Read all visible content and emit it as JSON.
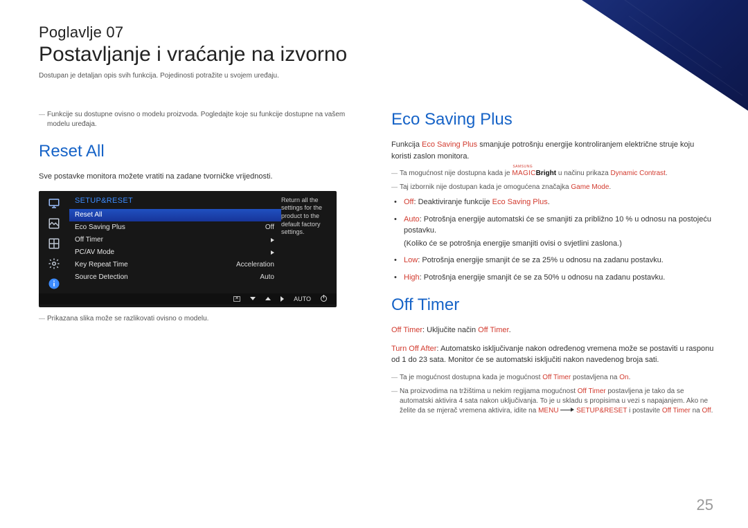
{
  "header": {
    "chapter": "Poglavlje 07",
    "title": "Postavljanje i vraćanje na izvorno",
    "intro": "Dostupan je detaljan opis svih funkcija. Pojedinosti potražite u svojem uređaju."
  },
  "left": {
    "model_note": "Funkcije su dostupne ovisno o modelu proizvoda. Pogledajte koje su funkcije dostupne na vašem modelu uređaja.",
    "reset_heading": "Reset All",
    "reset_desc": "Sve postavke monitora možete vratiti na zadane tvorničke vrijednosti.",
    "osd": {
      "title": "SETUP&RESET",
      "rows": [
        {
          "label": "Reset All",
          "value": ""
        },
        {
          "label": "Eco Saving Plus",
          "value": "Off"
        },
        {
          "label": "Off Timer",
          "value": "▶"
        },
        {
          "label": "PC/AV Mode",
          "value": "▶"
        },
        {
          "label": "Key Repeat Time",
          "value": "Acceleration"
        },
        {
          "label": "Source Detection",
          "value": "Auto"
        }
      ],
      "help": "Return all the settings for the product to the default factory settings.",
      "bottom_auto": "AUTO"
    },
    "image_note": "Prikazana slika može se razlikovati ovisno o modelu."
  },
  "right": {
    "eco": {
      "heading": "Eco Saving Plus",
      "p1a": "Funkcija ",
      "kw1": "Eco Saving Plus",
      "p1b": " smanjuje potrošnju energije kontroliranjem električne struje koju koristi zaslon monitora.",
      "note1a": "Ta mogućnost nije dostupna kada je ",
      "magic_sup": "SAMSUNG",
      "magic_main": "MAGIC",
      "magic_bright": "Bright",
      "note1b": " u načinu prikaza ",
      "note1c": "Dynamic Contrast",
      "note2a": "Taj izbornik nije dostupan kada je omogućena značajka ",
      "note2b": "Game Mode",
      "opts": [
        {
          "kw": "Off",
          "t1": "Deaktiviranje funkcije ",
          "kw2": "Eco Saving Plus"
        },
        {
          "kw": "Auto",
          "t1": "Potrošnja energije automatski će se smanjiti za približno 10 % u odnosu na postojeću postavku.",
          "sub": "(Koliko će se potrošnja energije smanjiti ovisi o svjetlini zaslona.)"
        },
        {
          "kw": "Low",
          "t1": "Potrošnja energije smanjit će se za 25% u odnosu na zadanu postavku."
        },
        {
          "kw": "High",
          "t1": "Potrošnja energije smanjit će se za 50% u odnosu na zadanu postavku."
        }
      ]
    },
    "timer": {
      "heading": "Off Timer",
      "l1a": "Off Timer",
      "l1b": "Uključite način ",
      "l1c": "Off Timer",
      "l2a": "Turn Off After",
      "l2b": "Automatsko isključivanje nakon određenog vremena može se postaviti u rasponu od 1 do 23 sata. Monitor će se automatski isključiti nakon navedenog broja sati.",
      "n1a": "Ta je mogućnost dostupna kada je mogućnost ",
      "n1b": "Off Timer",
      "n1c": " postavljena na ",
      "n1d": "On",
      "n2a": "Na proizvodima na tržištima u nekim regijama mogućnost ",
      "n2b": "Off Timer",
      "n2c": " postavljena je tako da se automatski aktivira 4 sata nakon uključivanja. To je u skladu s propisima u vezi s napajanjem. Ako ne želite da se mjerač vremena aktivira, idite na ",
      "n2d": "MENU",
      "n2e": "SETUP&RESET",
      "n2f": " i postavite ",
      "n2g": "Off Timer",
      "n2h": " na ",
      "n2i": "Off"
    }
  },
  "page_number": "25"
}
